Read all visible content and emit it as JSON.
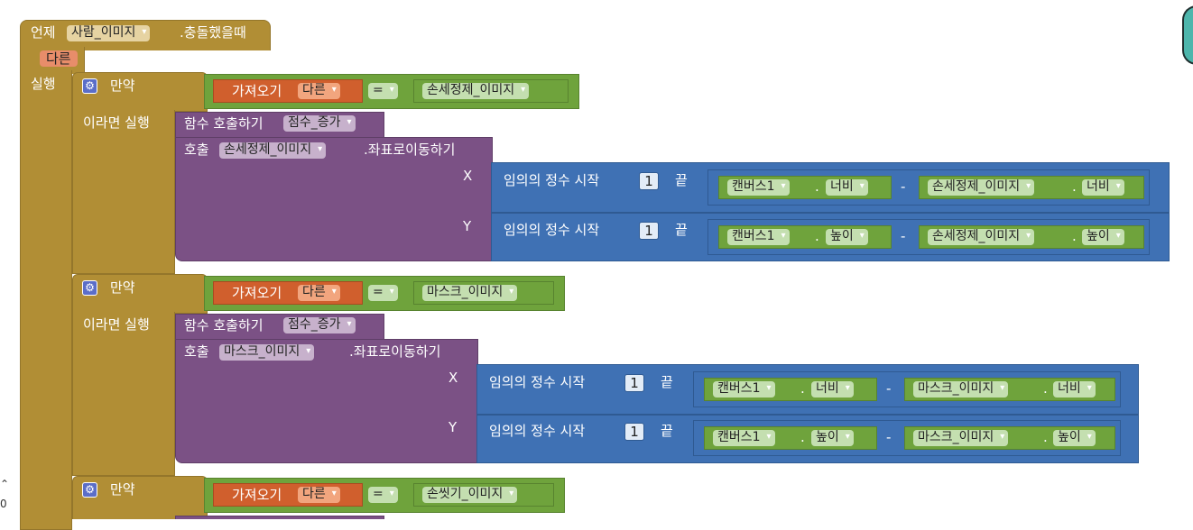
{
  "event": {
    "when": "언제",
    "component": "사람_이미지",
    "event_name": ".충돌했을때",
    "param": "다른",
    "do": "실행"
  },
  "if_label": "만약",
  "then_label": "이라면 실행",
  "get_label": "가져오기",
  "get_var": "다른",
  "eq_op": "=",
  "call_func_label": "함수 호출하기",
  "score_func": "점수_증가",
  "call_label": "호출",
  "move_method": ".좌표로이동하기",
  "x_label": "X",
  "y_label": "Y",
  "random_label": "임의의 정수 시작",
  "end_label": "끝",
  "random_from": "1",
  "canvas": "캔버스1",
  "dot": ".",
  "width": "너비",
  "height": "높이",
  "minus": "-",
  "branches": [
    {
      "target": "손세정제_이미지"
    },
    {
      "target": "마스크_이미지"
    },
    {
      "target": "손씻기_이미지"
    }
  ],
  "scroll": {
    "up": "⌃",
    "zero": "0"
  }
}
